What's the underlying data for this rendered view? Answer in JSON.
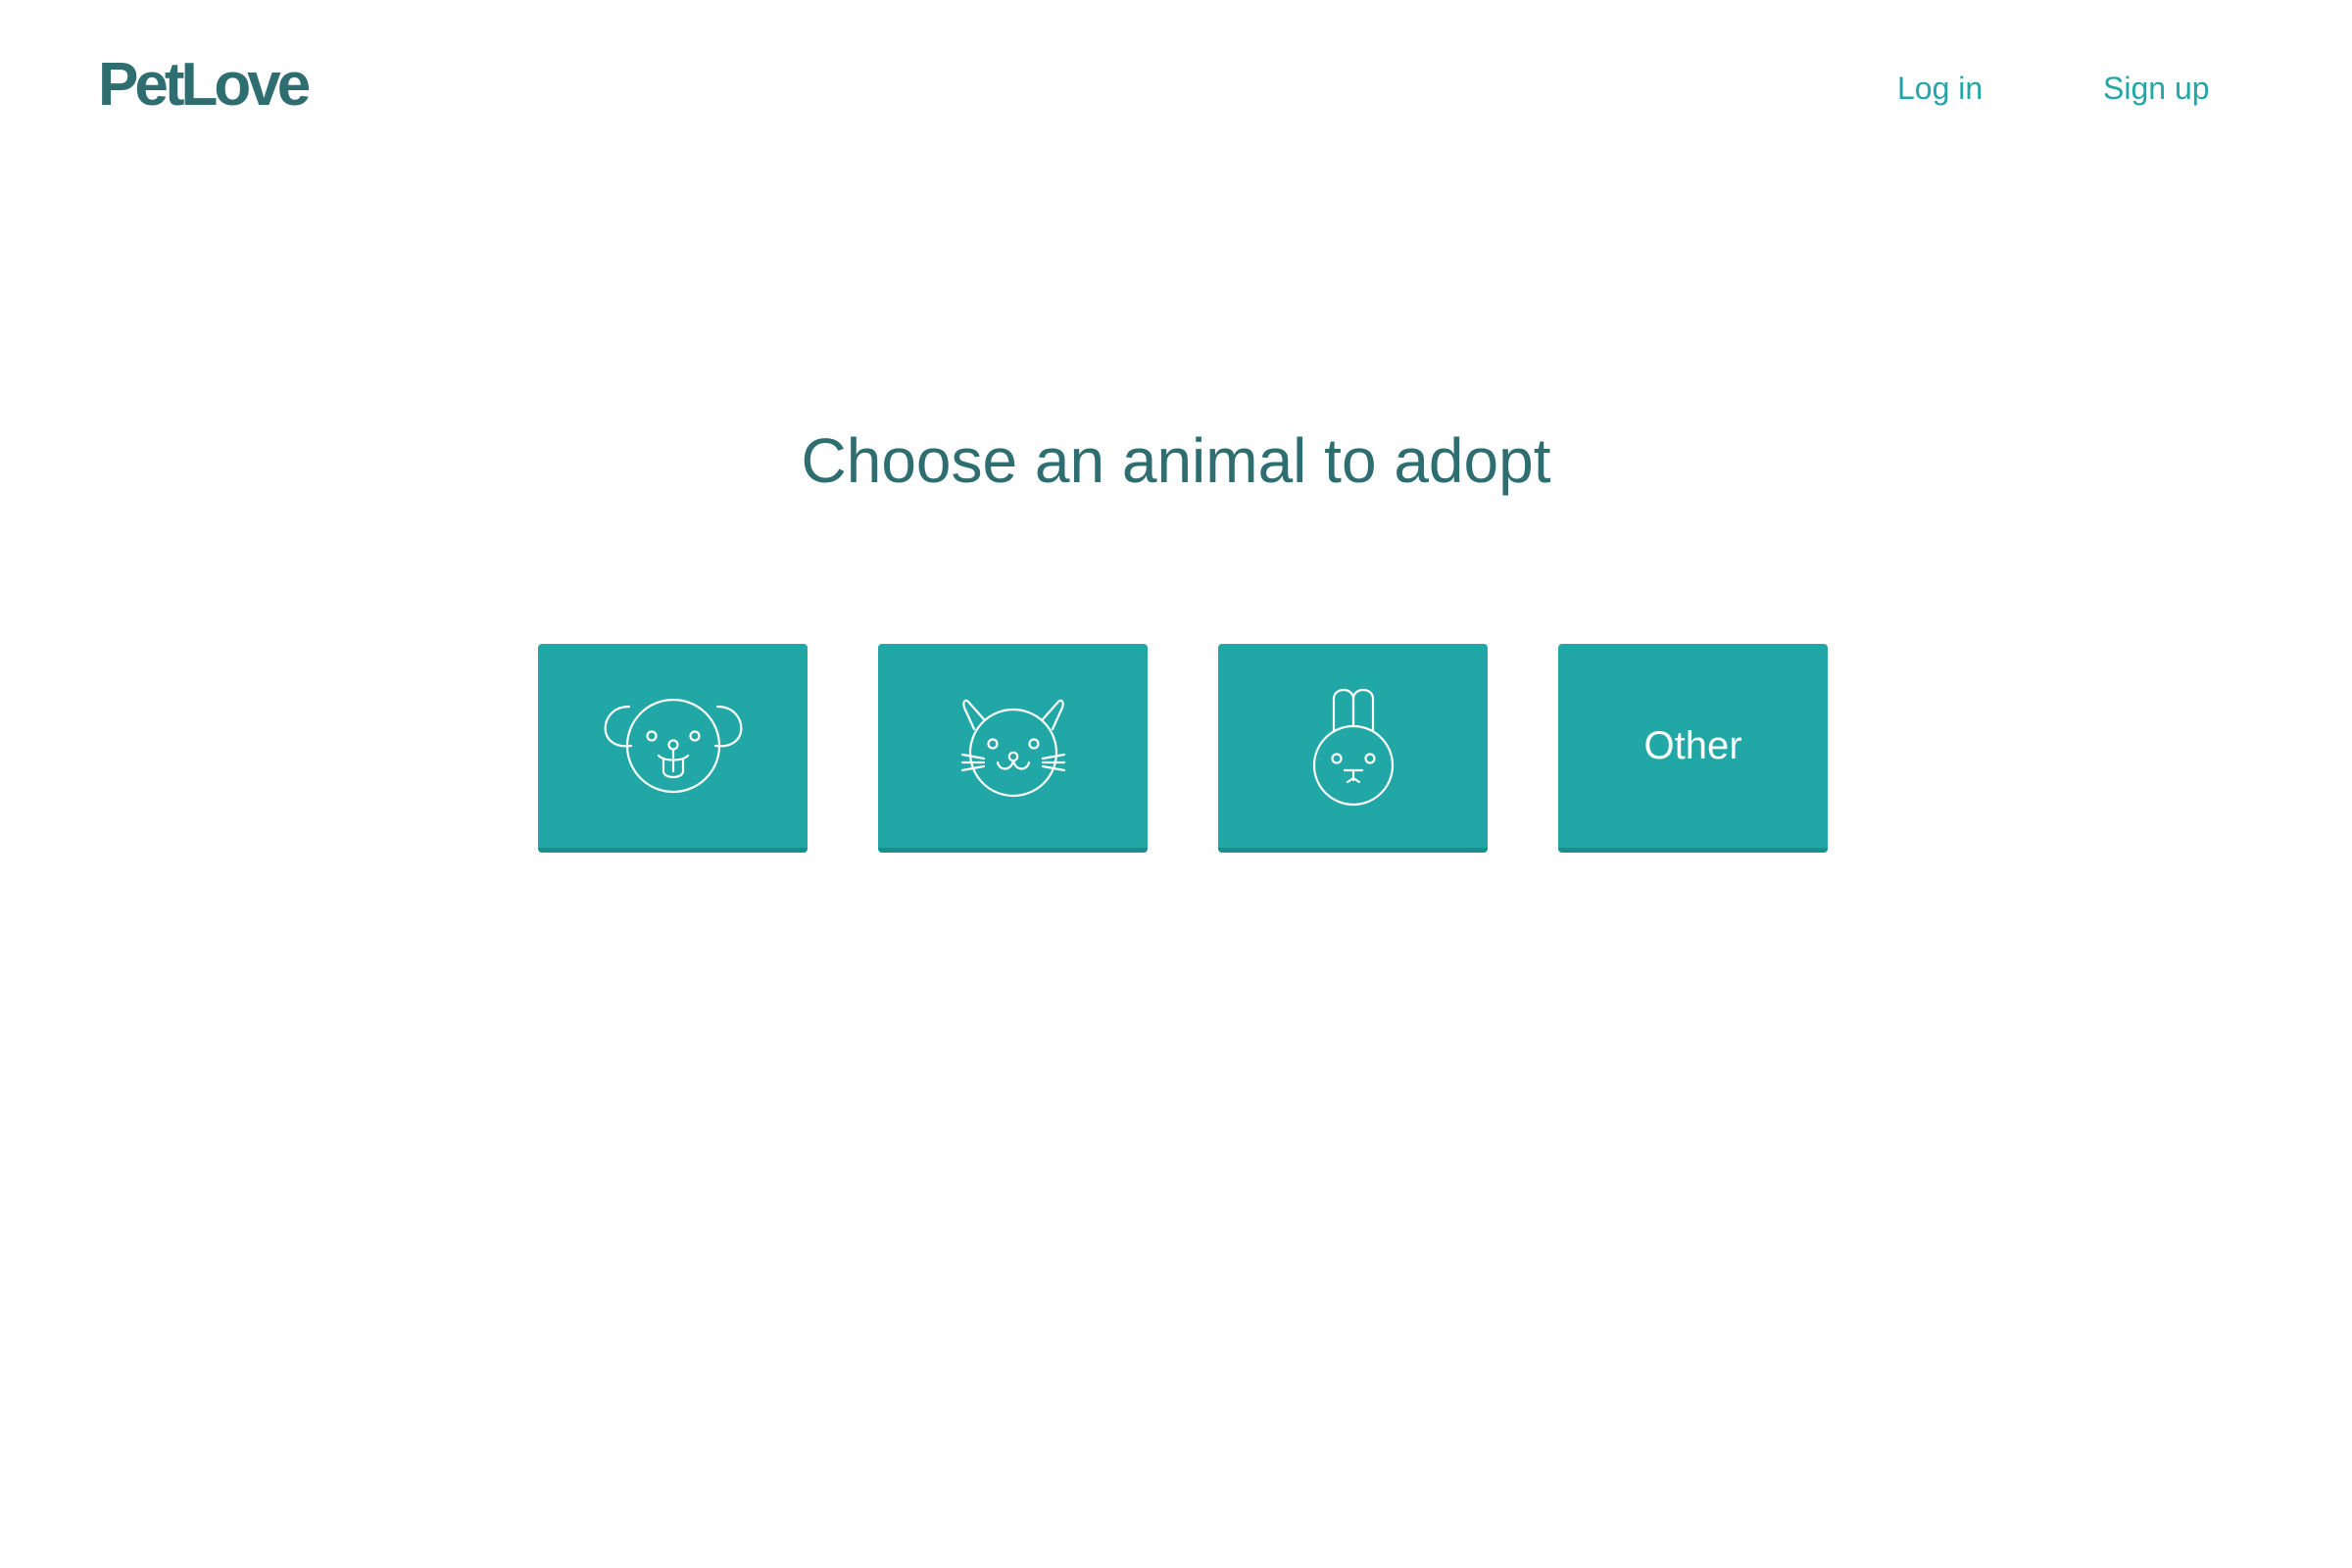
{
  "header": {
    "logo": "PetLove",
    "nav": {
      "login": "Log in",
      "signup": "Sign up"
    }
  },
  "main": {
    "title": "Choose an animal to adopt",
    "options": [
      {
        "icon": "dog-icon"
      },
      {
        "icon": "cat-icon"
      },
      {
        "icon": "rabbit-icon"
      },
      {
        "label": "Other"
      }
    ]
  },
  "colors": {
    "brand": "#2e6e70",
    "accent": "#22a7a7",
    "link": "#22a6a7"
  }
}
